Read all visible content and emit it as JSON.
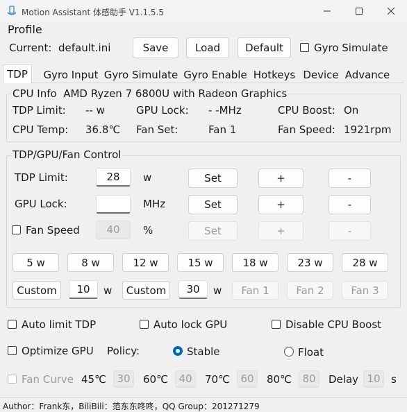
{
  "window": {
    "title": "Motion Assistant 体感助手 V1.1.5.5",
    "minimize_icon": "minimize-icon",
    "maximize_icon": "maximize-icon",
    "close_icon": "close-icon"
  },
  "profile": {
    "section_label": "Profile",
    "current_label": "Current:",
    "current_value": "default.ini",
    "save_label": "Save",
    "load_label": "Load",
    "default_label": "Default",
    "gyro_simulate_label": "Gyro Simulate",
    "gyro_simulate_checked": false
  },
  "tabs": [
    {
      "label": "TDP",
      "active": true
    },
    {
      "label": "Gyro Input",
      "active": false
    },
    {
      "label": "Gyro Simulate",
      "active": false
    },
    {
      "label": "Gyro Enable",
      "active": false
    },
    {
      "label": "Hotkeys",
      "active": false
    },
    {
      "label": "Device",
      "active": false
    },
    {
      "label": "Advance",
      "active": false
    }
  ],
  "cpu_info": {
    "title": "CPU Info",
    "cpu_name": "AMD Ryzen 7 6800U with Radeon Graphics",
    "tdp_limit_label": "TDP Limit:",
    "tdp_limit_value": "-- w",
    "gpu_lock_label": "GPU Lock:",
    "gpu_lock_value": "- -MHz",
    "cpu_boost_label": "CPU Boost:",
    "cpu_boost_value": "On",
    "cpu_temp_label": "CPU Temp:",
    "cpu_temp_value": "36.8℃",
    "fan_set_label": "Fan Set:",
    "fan_set_value": "Fan 1",
    "fan_speed_label": "Fan Speed:",
    "fan_speed_value": "1921rpm"
  },
  "control": {
    "title": "TDP/GPU/Fan Control",
    "tdp_limit_label": "TDP Limit:",
    "tdp_limit_value": "28",
    "tdp_unit": "w",
    "gpu_lock_label": "GPU Lock:",
    "gpu_lock_value": "",
    "gpu_unit": "MHz",
    "fan_speed_label": "Fan Speed",
    "fan_speed_checked": false,
    "fan_speed_value": "40",
    "fan_unit": "%",
    "set_label": "Set",
    "plus_label": "+",
    "minus_label": "-",
    "presets": [
      "5 w",
      "8 w",
      "12 w",
      "15 w",
      "18 w",
      "23 w",
      "28 w"
    ],
    "custom1_label": "Custom",
    "custom1_value": "10",
    "custom1_unit": "w",
    "custom2_label": "Custom",
    "custom2_value": "30",
    "custom2_unit": "w",
    "fan_buttons": [
      "Fan 1",
      "Fan 2",
      "Fan 3"
    ]
  },
  "options": {
    "auto_limit_tdp": "Auto limit TDP",
    "auto_lock_gpu": "Auto lock GPU",
    "disable_cpu_boost": "Disable CPU Boost",
    "optimize_gpu": "Optimize GPU",
    "policy_label": "Policy:",
    "policy_stable": "Stable",
    "policy_float": "Float",
    "policy_selected": "Stable"
  },
  "fan_curve": {
    "label": "Fan Curve",
    "t1": "45℃",
    "v1": "30",
    "t2": "60℃",
    "v2": "40",
    "t3": "70℃",
    "v3": "60",
    "t4": "80℃",
    "v4": "80",
    "delay_label": "Delay",
    "delay_value": "10",
    "delay_unit": "s"
  },
  "status": {
    "text": "Author：Frank东，BiliBili：范东东咚咚，QQ Group：201271279"
  },
  "colors": {
    "accent": "#0067c0",
    "background": "#f0f0f0"
  }
}
